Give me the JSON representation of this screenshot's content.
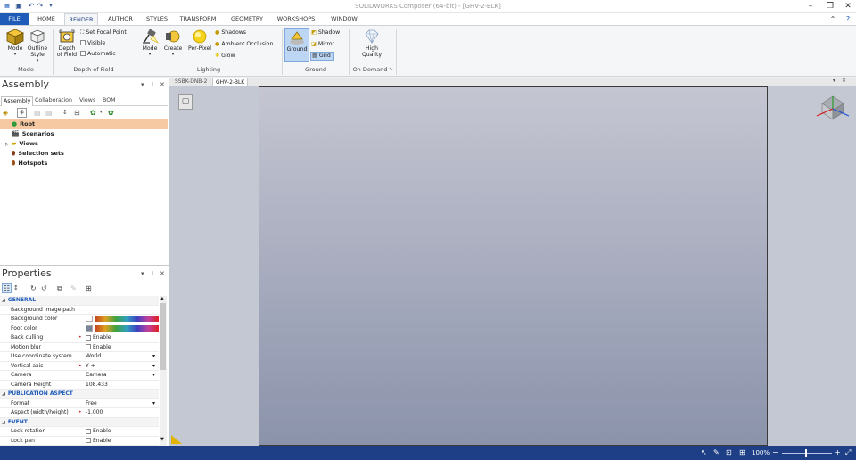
{
  "app": {
    "title": "SOLIDWORKS Composer (64-bit) - [GHV-2-BLK]"
  },
  "quick_access": {
    "icons": [
      "app-logo-icon",
      "save-icon",
      "undo-icon",
      "redo-icon",
      "customize-icon"
    ]
  },
  "window_controls": {
    "minimize": "–",
    "restore": "❐",
    "close": "✕",
    "help": "?"
  },
  "tabs": [
    "FILE",
    "HOME",
    "RENDER",
    "AUTHOR",
    "STYLES",
    "TRANSFORM",
    "GEOMETRY",
    "WORKSHOPS",
    "WINDOW"
  ],
  "active_tab": "RENDER",
  "ribbon": {
    "mode": {
      "mode_label": "Mode",
      "outline_label": "Outline Style",
      "group": "Mode"
    },
    "dof": {
      "depth_label": "Depth of Field",
      "set_focal": "Set Focal Point",
      "visible": "Visible",
      "automatic": "Automatic",
      "group": "Depth of Field"
    },
    "lighting": {
      "mode": "Mode",
      "create": "Create",
      "per_pixel": "Per-Pixel",
      "shadows": "Shadows",
      "ambient": "Ambient Occlusion",
      "glow": "Glow",
      "group": "Lighting"
    },
    "ground": {
      "ground": "Ground",
      "shadow": "Shadow",
      "mirror": "Mirror",
      "grid": "Grid",
      "group": "Ground"
    },
    "on_demand": {
      "high_quality": "High Quality",
      "group": "On Demand"
    }
  },
  "assembly": {
    "title": "Assembly",
    "tabs": [
      "Assembly",
      "Collaboration",
      "Views",
      "BOM"
    ],
    "tree": [
      {
        "label": "Root",
        "icon": "root-icon",
        "selected": true
      },
      {
        "label": "Scenarios",
        "icon": "scenarios-icon"
      },
      {
        "label": "Views",
        "icon": "views-folder-icon",
        "expander": "▷"
      },
      {
        "label": "Selection sets",
        "icon": "selection-sets-icon"
      },
      {
        "label": "Hotspots",
        "icon": "hotspots-icon"
      }
    ]
  },
  "properties": {
    "title": "Properties",
    "rows": [
      {
        "type": "cat",
        "label": "GENERAL"
      },
      {
        "label": "Background image path",
        "value": ""
      },
      {
        "label": "Background color",
        "value": "",
        "kind": "color-white"
      },
      {
        "label": "Foot color",
        "value": "",
        "kind": "color-gray"
      },
      {
        "label": "Back culling",
        "value": "Enable",
        "kind": "check",
        "dot": true
      },
      {
        "label": "Motion blur",
        "value": "Enable",
        "kind": "check"
      },
      {
        "label": "Use coordinate system",
        "value": "World",
        "kind": "combo"
      },
      {
        "label": "Vertical axis",
        "value": "Y +",
        "kind": "combo",
        "dot": true
      },
      {
        "label": "Camera",
        "value": "Camera",
        "kind": "combo"
      },
      {
        "label": "Camera Height",
        "value": "108.433"
      },
      {
        "type": "cat",
        "label": "PUBLICATION ASPECT"
      },
      {
        "label": "Format",
        "value": "Free",
        "kind": "combo"
      },
      {
        "label": "Aspect (width/height)",
        "value": "-1.000",
        "dot": true
      },
      {
        "type": "cat",
        "label": "EVENT"
      },
      {
        "label": "Lock rotation",
        "value": "Enable",
        "kind": "check"
      },
      {
        "label": "Lock pan",
        "value": "Enable",
        "kind": "check"
      }
    ]
  },
  "doc_tabs": [
    "SSBK-DNB-2",
    "GHV-2-BLK"
  ],
  "active_doc": "GHV-2-BLK",
  "status": {
    "zoom": "100%"
  },
  "colors": {
    "accent": "#1e5bb8",
    "status_bar": "#1e3f86",
    "selected_row": "#f7c9a2"
  }
}
